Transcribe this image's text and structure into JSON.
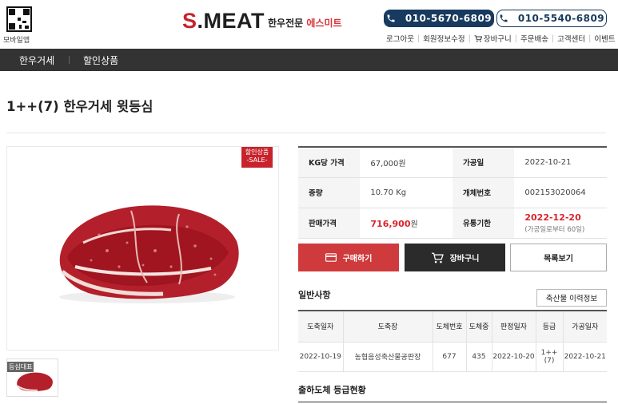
{
  "header": {
    "qr_caption": "모바일앱",
    "logo_main_s": "S",
    "logo_main_rest": ".MEAT",
    "logo_sub_black": "한우전문",
    "logo_sub_red": "에스미트",
    "phones": [
      "010-5670-6809",
      "010-5540-6809"
    ],
    "util": [
      "로그아웃",
      "회원정보수정",
      "장바구니",
      "주문배송",
      "고객센터",
      "이벤트"
    ]
  },
  "nav": [
    "한우거세",
    "할인상품"
  ],
  "product": {
    "title": "1++(7) 한우거세 윗등심",
    "badge_line1": "할인상품",
    "badge_line2": "-SALE-",
    "thumb_tag": "등심대표"
  },
  "info": {
    "kg_price_label": "KG당 가격",
    "kg_price": "67,000원",
    "process_date_label": "가공일",
    "process_date": "2022-10-21",
    "weight_label": "중량",
    "weight": "10.70 Kg",
    "id_label": "개체번호",
    "id_value": "002153020064",
    "sale_price_label": "판매가격",
    "sale_price_num": "716,900",
    "sale_price_unit": "원",
    "expiry_label": "유통기한",
    "expiry": "2022-12-20",
    "expiry_note": "(가공일로부터 60일)"
  },
  "buttons": {
    "buy": "구매하기",
    "cart": "장바구니",
    "list": "목록보기"
  },
  "general": {
    "title": "일반사항",
    "trace_button": "축산물 이력정보",
    "headers": [
      "도축일자",
      "도축장",
      "도체번호",
      "도체중",
      "판정일자",
      "등급",
      "가공일자"
    ],
    "row": [
      "2022-10-19",
      "농협음성축산물공판장",
      "677",
      "435",
      "2022-10-20",
      "1++(7)",
      "2022-10-21"
    ]
  },
  "section2_title": "출하도체 등급현황",
  "colors": {
    "brand_red": "#c8232c",
    "navy": "#173a5e",
    "nav_bg": "#333333"
  }
}
